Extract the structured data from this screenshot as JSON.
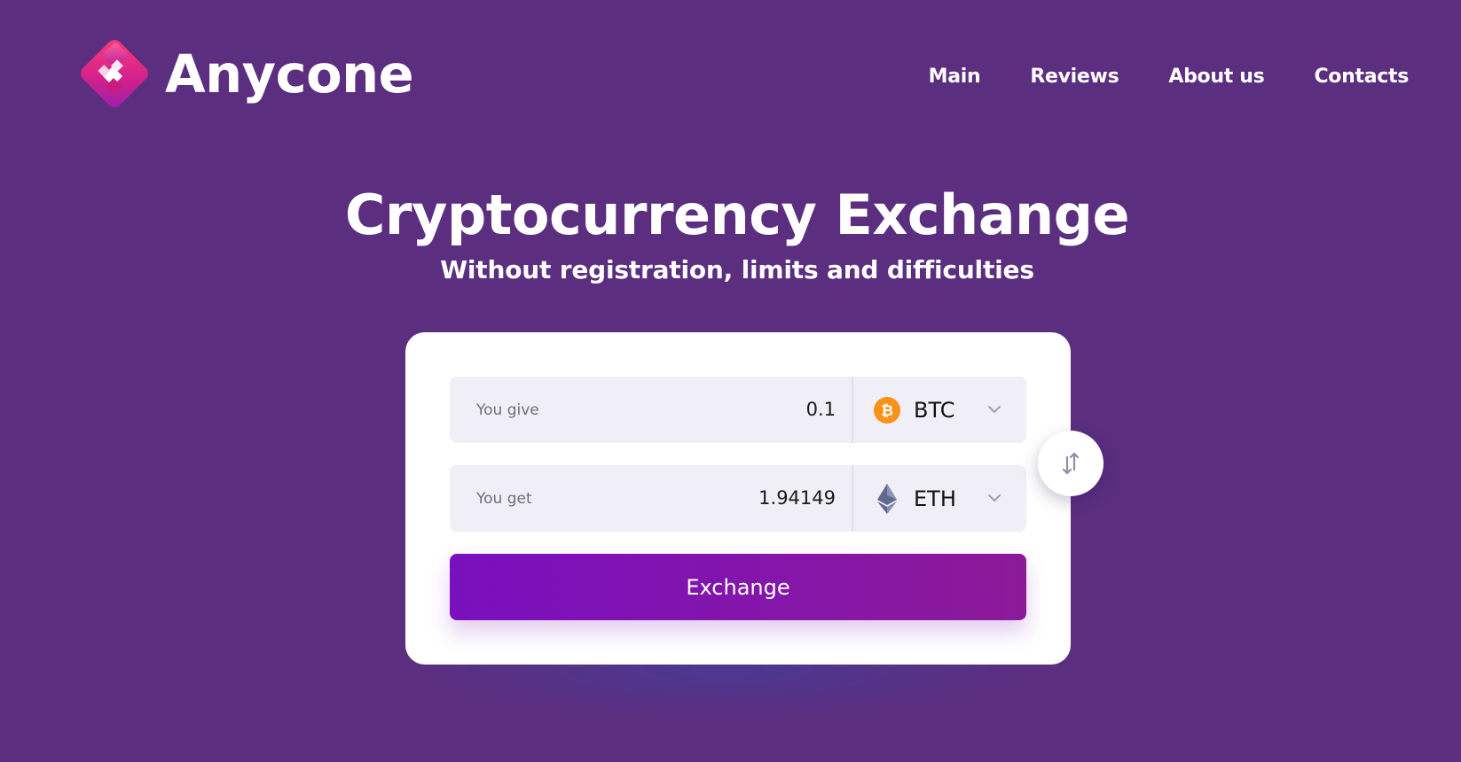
{
  "brand": {
    "name": "Anycone"
  },
  "nav": {
    "items": [
      {
        "label": "Main"
      },
      {
        "label": "Reviews"
      },
      {
        "label": "About us"
      },
      {
        "label": "Contacts"
      }
    ]
  },
  "hero": {
    "title": "Cryptocurrency Exchange",
    "subtitle": "Without registration, limits and difficulties"
  },
  "exchange": {
    "give": {
      "label": "You give",
      "value": "0.1",
      "currency": "BTC",
      "icon": "bitcoin-icon"
    },
    "get": {
      "label": "You get",
      "value": "1.94149",
      "currency": "ETH",
      "icon": "ethereum-icon"
    },
    "button_label": "Exchange",
    "swap_icon": "swap-arrows-icon"
  },
  "colors": {
    "background": "#5b2e80",
    "button_start": "#7a0fbe",
    "button_end": "#8c1a98",
    "bitcoin": "#f7931a",
    "field_bg": "#f0eef6"
  }
}
